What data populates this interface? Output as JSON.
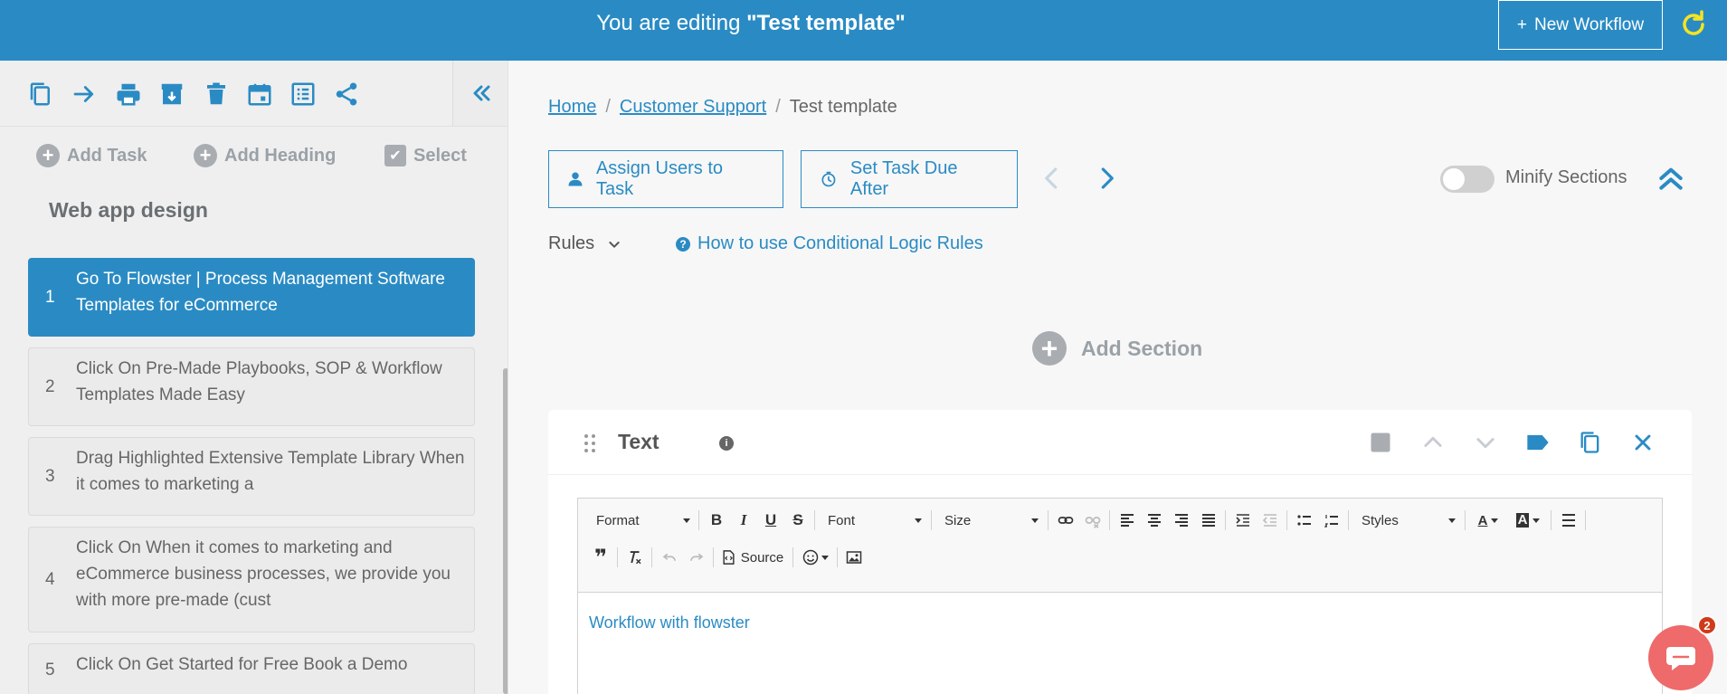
{
  "header": {
    "title_prefix": "You are editing ",
    "template_name": "\"Test template\"",
    "new_workflow_label": "New Workflow"
  },
  "sidebar": {
    "add_task": "Add Task",
    "add_heading": "Add Heading",
    "select": "Select",
    "section_title": "Web app design",
    "tasks": [
      {
        "num": "1",
        "text": "Go To Flowster | Process Management Software Templates for eCommerce",
        "active": true
      },
      {
        "num": "2",
        "text": "Click On Pre-Made Playbooks, SOP & Workflow Templates Made Easy"
      },
      {
        "num": "3",
        "text": "Drag Highlighted Extensive Template Library When it comes to marketing a"
      },
      {
        "num": "4",
        "text": "Click On When it comes to marketing and eCommerce business processes, we provide you with more pre-made (cust"
      },
      {
        "num": "5",
        "text": "Click On Get Started for Free Book a Demo"
      }
    ]
  },
  "main": {
    "breadcrumb": {
      "home": "Home",
      "parent": "Customer Support",
      "current": "Test template",
      "sep": "/"
    },
    "assign_users": "Assign Users to Task",
    "set_due": "Set Task Due After",
    "minify_sections": "Minify Sections",
    "rules_label": "Rules",
    "help_link": "How to use Conditional Logic Rules",
    "add_section": "Add Section",
    "card": {
      "title": "Text",
      "info_glyph": "i",
      "toolbar": {
        "format": "Format",
        "font": "Font",
        "size": "Size",
        "styles": "Styles",
        "source": "Source",
        "bold": "B",
        "italic": "I",
        "underline": "U",
        "strike": "S",
        "quote": "❞",
        "text_color": "A",
        "bg_color": "A"
      },
      "content": "Workflow with flowster"
    }
  },
  "chat": {
    "badge": "2"
  },
  "colors": {
    "accent": "#2a8bc4",
    "chat": "#ef6a6a",
    "badge": "#d03a1a",
    "refresh": "#f4e422"
  }
}
